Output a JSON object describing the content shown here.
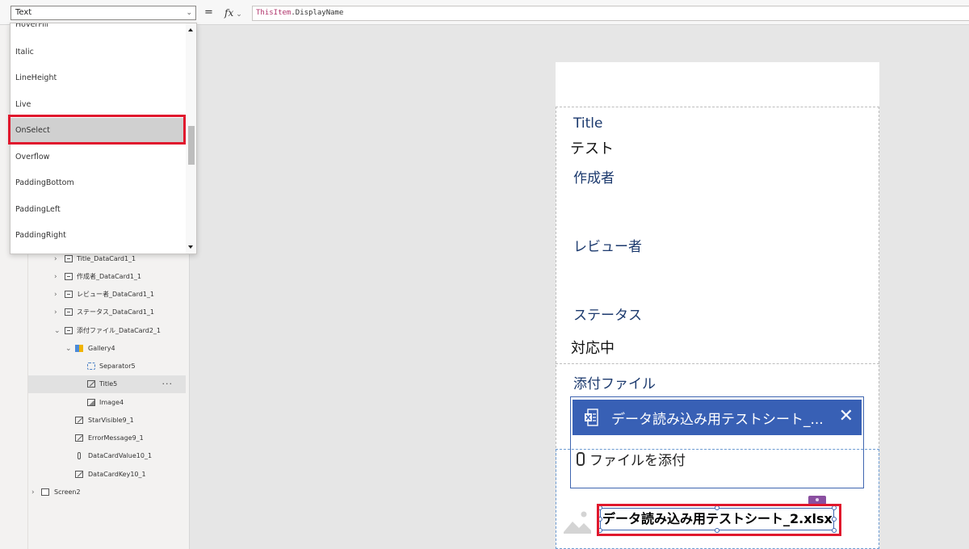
{
  "formula_bar": {
    "property": "Text",
    "equals": "=",
    "fx_label": "fx",
    "formula_keyword": "ThisItem",
    "formula_rest": ".DisplayName"
  },
  "property_dropdown": {
    "items": [
      "HoverFill",
      "Italic",
      "LineHeight",
      "Live",
      "OnSelect",
      "Overflow",
      "PaddingBottom",
      "PaddingLeft",
      "PaddingRight"
    ],
    "highlighted": "OnSelect"
  },
  "tree_view": {
    "items": [
      {
        "label": "Title_DataCard1_1",
        "icon": "card-icon"
      },
      {
        "label": "作成者_DataCard1_1",
        "icon": "card-icon"
      },
      {
        "label": "レビュー者_DataCard1_1",
        "icon": "card-icon"
      },
      {
        "label": "ステータス_DataCard1_1",
        "icon": "card-icon"
      },
      {
        "label": "添付ファイル_DataCard2_1",
        "icon": "card-icon"
      },
      {
        "label": "Gallery4",
        "icon": "gallery-icon"
      },
      {
        "label": "Separator5",
        "icon": "separator-icon"
      },
      {
        "label": "Title5",
        "icon": "label-edit-icon",
        "selected": true,
        "more": "···"
      },
      {
        "label": "Image4",
        "icon": "image-icon"
      },
      {
        "label": "StarVisible9_1",
        "icon": "label-edit-icon"
      },
      {
        "label": "ErrorMessage9_1",
        "icon": "label-edit-icon"
      },
      {
        "label": "DataCardValue10_1",
        "icon": "attachment-icon"
      },
      {
        "label": "DataCardKey10_1",
        "icon": "label-edit-icon"
      },
      {
        "label": "Screen2",
        "icon": "screen-icon"
      }
    ]
  },
  "form": {
    "title_label": "Title",
    "title_value": "テスト",
    "author_label": "作成者",
    "reviewer_label": "レビュー者",
    "status_label": "ステータス",
    "status_value": "対応中",
    "attachments_label": "添付ファイル",
    "attached_file": "データ読み込み用テストシート_...",
    "close_glyph": "✕",
    "attach_link": "ファイルを添付",
    "gallery_title": "データ読み込み用テストシート_2.xlsx"
  },
  "colors": {
    "highlight_red": "#e0182d",
    "chip_blue": "#3860b5",
    "label_navy": "#1c3a6e",
    "formula_keyword": "#b0346b"
  }
}
